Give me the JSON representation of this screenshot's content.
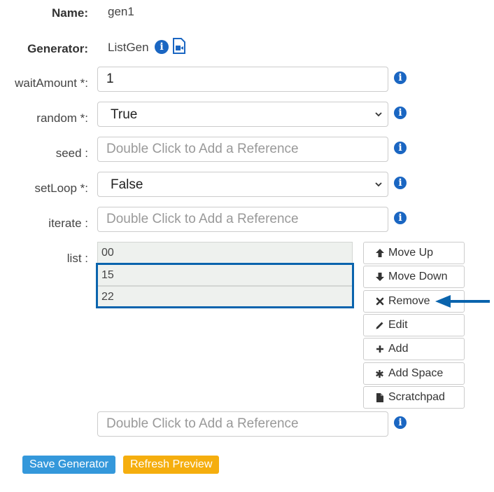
{
  "name": {
    "label": "Name:",
    "value": "gen1"
  },
  "generator": {
    "label": "Generator:",
    "value": "ListGen"
  },
  "fields": {
    "waitAmount": {
      "label": "waitAmount *:",
      "value": "1"
    },
    "random": {
      "label": "random *:",
      "value": "True",
      "options": [
        "True"
      ]
    },
    "seed": {
      "label": "seed :",
      "placeholder": "Double Click to Add a Reference"
    },
    "setLoop": {
      "label": "setLoop *:",
      "value": "False",
      "options": [
        "False"
      ]
    },
    "iterate": {
      "label": "iterate :",
      "placeholder": "Double Click to Add a Reference"
    },
    "list": {
      "label": "list :",
      "items": [
        "00",
        "15",
        "22"
      ]
    },
    "new_ref": {
      "placeholder": "Double Click to Add a Reference"
    }
  },
  "actions": {
    "move_up": "Move Up",
    "move_down": "Move Down",
    "remove": "Remove",
    "edit": "Edit",
    "add": "Add",
    "add_space": "Add Space",
    "scratchpad": "Scratchpad"
  },
  "footer": {
    "save": "Save Generator",
    "refresh": "Refresh Preview"
  },
  "icons": {
    "info": "info-circle-icon",
    "doc": "video-document-icon"
  },
  "colors": {
    "info_blue": "#1a66c2",
    "highlight": "#0a64ad",
    "save_button": "#3498db",
    "refresh_button": "#f5ae0e"
  }
}
